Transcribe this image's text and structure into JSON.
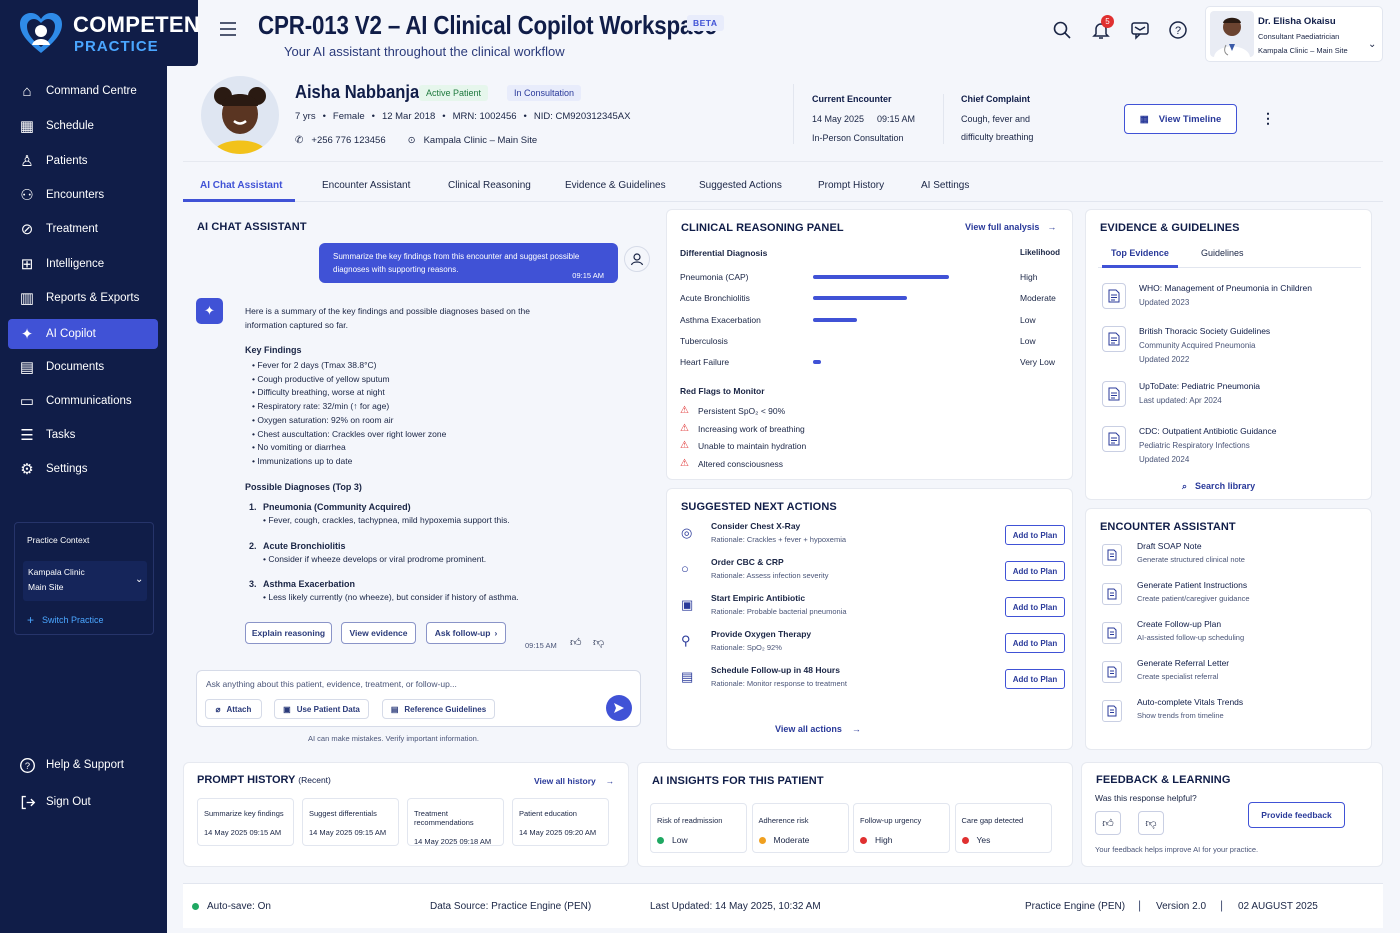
{
  "brand": {
    "line1": "COMPETEN",
    "line2": "PRACTICE"
  },
  "header": {
    "title": "CPR-013 V2 – AI Clinical Copilot Workspace",
    "beta": "BETA",
    "subtitle": "Your AI assistant throughout the clinical workflow",
    "notifications": "5",
    "user_name": "Dr. Elisha Okaisu",
    "user_role": "Consultant Paediatrician",
    "user_site": "Kampala Clinic – Main Site"
  },
  "nav": [
    "Command Centre",
    "Schedule",
    "Patients",
    "Encounters",
    "Treatment",
    "Intelligence",
    "Reports & Exports",
    "AI Copilot",
    "Documents",
    "Communications",
    "Tasks",
    "Settings"
  ],
  "nav_bottom": [
    "Help & Support",
    "Sign Out"
  ],
  "context": {
    "title": "Practice Context",
    "clinic": "Kampala Clinic",
    "site": "Main Site",
    "switch": "Switch Practice"
  },
  "patient": {
    "name": "Aisha Nabbanja",
    "status1": "Active Patient",
    "status2": "In Consultation",
    "age": "7 yrs",
    "sex": "Female",
    "dob": "12 Mar 2018",
    "mrn": "MRN: 1002456",
    "nid": "NID: CM920312345AX",
    "phone": "+256 776 123456",
    "clinic": "Kampala Clinic – Main Site",
    "enc_label": "Current Encounter",
    "enc_date": "14 May 2025",
    "enc_time": "09:15 AM",
    "enc_type": "In-Person Consultation",
    "cc_label": "Chief Complaint",
    "cc_line1": "Cough, fever and",
    "cc_line2": "difficulty breathing",
    "timeline": "View Timeline"
  },
  "tabs": [
    "AI Chat Assistant",
    "Encounter Assistant",
    "Clinical Reasoning",
    "Evidence & Guidelines",
    "Suggested Actions",
    "Prompt History",
    "AI Settings"
  ],
  "chat": {
    "title": "AI CHAT ASSISTANT",
    "user_msg_1": "Summarize the key findings from this encounter and suggest possible",
    "user_msg_2": "diagnoses with supporting reasons.",
    "user_time": "09:15 AM",
    "intro_1": "Here is a summary of the key findings and possible diagnoses based on the",
    "intro_2": "information captured so far.",
    "kf_title": "Key Findings",
    "findings": [
      "Fever for 2 days (Tmax 38.8°C)",
      "Cough productive of yellow sputum",
      "Difficulty breathing, worse at night",
      "Respiratory rate: 32/min (↑ for age)",
      "Oxygen saturation: 92% on room air",
      "Chest auscultation: Crackles over right lower zone",
      "No vomiting or diarrhea",
      "Immunizations up to date"
    ],
    "pd_title": "Possible Diagnoses (Top 3)",
    "dx": [
      {
        "num": "1.",
        "name": "Pneumonia (Community Acquired)",
        "note": "Fever, cough, crackles, tachypnea, mild hypoxemia support this."
      },
      {
        "num": "2.",
        "name": "Acute Bronchiolitis",
        "note": "Consider if wheeze develops or viral prodrome prominent."
      },
      {
        "num": "3.",
        "name": "Asthma Exacerbation",
        "note": "Less likely currently (no wheeze), but consider if history of asthma."
      }
    ],
    "btn_explain": "Explain reasoning",
    "btn_evidence": "View evidence",
    "btn_follow": "Ask follow-up",
    "ai_time": "09:15 AM",
    "input_placeholder": "Ask anything about this patient, evidence, treatment, or follow-up...",
    "attach": "Attach",
    "use_data": "Use Patient Data",
    "ref": "Reference Guidelines",
    "disclaimer": "AI can make mistakes. Verify important information."
  },
  "reasoning": {
    "title": "CLINICAL REASONING PANEL",
    "view_full": "View full analysis",
    "dd_label": "Differential Diagnosis",
    "lk_label": "Likelihood",
    "items": [
      {
        "name": "Pneumonia (CAP)",
        "level": "High",
        "value": 0.68
      },
      {
        "name": "Acute Bronchiolitis",
        "level": "Moderate",
        "value": 0.47
      },
      {
        "name": "Asthma Exacerbation",
        "level": "Low",
        "value": 0.22
      },
      {
        "name": "Tuberculosis",
        "level": "Low",
        "value": 0
      },
      {
        "name": "Heart Failure",
        "level": "Very Low",
        "value": 0.04
      }
    ],
    "rf_title": "Red Flags to Monitor",
    "flags": [
      "Persistent SpO₂ < 90%",
      "Increasing work of breathing",
      "Unable to maintain hydration",
      "Altered consciousness"
    ]
  },
  "actions": {
    "title": "SUGGESTED NEXT ACTIONS",
    "add": "Add to Plan",
    "view_all": "View all actions",
    "items": [
      {
        "name": "Consider Chest X-Ray",
        "rationale": "Rationale: Crackles + fever + hypoxemia"
      },
      {
        "name": "Order CBC & CRP",
        "rationale": "Rationale: Assess infection severity"
      },
      {
        "name": "Start Empiric Antibiotic",
        "rationale": "Rationale: Probable bacterial pneumonia"
      },
      {
        "name": "Provide Oxygen Therapy",
        "rationale": "Rationale: SpO₂ 92%"
      },
      {
        "name": "Schedule Follow-up in 48 Hours",
        "rationale": "Rationale: Monitor response to treatment"
      }
    ]
  },
  "evidence": {
    "title": "EVIDENCE & GUIDELINES",
    "tab1": "Top Evidence",
    "tab2": "Guidelines",
    "search": "Search library",
    "items": [
      {
        "l1": "WHO: Management of Pneumonia in Children",
        "l2": "Updated 2023",
        "l3": ""
      },
      {
        "l1": "British Thoracic Society Guidelines",
        "l2": "Community Acquired Pneumonia",
        "l3": "Updated 2022"
      },
      {
        "l1": "UpToDate: Pediatric Pneumonia",
        "l2": "Last updated: Apr 2024",
        "l3": ""
      },
      {
        "l1": "CDC: Outpatient Antibiotic Guidance",
        "l2": "Pediatric Respiratory Infections",
        "l3": "Updated 2024"
      }
    ]
  },
  "encounter": {
    "title": "ENCOUNTER ASSISTANT",
    "items": [
      {
        "name": "Draft SOAP Note",
        "desc": "Generate structured clinical note"
      },
      {
        "name": "Generate Patient Instructions",
        "desc": "Create patient/caregiver guidance"
      },
      {
        "name": "Create Follow-up Plan",
        "desc": "AI-assisted follow-up scheduling"
      },
      {
        "name": "Generate Referral Letter",
        "desc": "Create specialist referral"
      },
      {
        "name": "Auto-complete Vitals Trends",
        "desc": "Show trends from timeline"
      }
    ]
  },
  "history": {
    "title": "PROMPT HISTORY",
    "recent": "(Recent)",
    "view_all": "View all history",
    "items": [
      {
        "name": "Summarize key findings",
        "time": "14 May 2025 09:15 AM"
      },
      {
        "name": "Suggest differentials",
        "time": "14 May 2025 09:15 AM"
      },
      {
        "name": "Treatment recommendations",
        "time": "14 May 2025 09:18 AM"
      },
      {
        "name": "Patient education",
        "time": "14 May 2025 09:20 AM"
      }
    ]
  },
  "insights": {
    "title": "AI INSIGHTS FOR THIS PATIENT",
    "items": [
      {
        "label": "Risk of readmission",
        "value": "Low",
        "color": "#1fa862"
      },
      {
        "label": "Adherence risk",
        "value": "Moderate",
        "color": "#f0a020"
      },
      {
        "label": "Follow-up urgency",
        "value": "High",
        "color": "#e03030"
      },
      {
        "label": "Care gap detected",
        "value": "Yes",
        "color": "#e03030"
      }
    ]
  },
  "feedback": {
    "title": "FEEDBACK & LEARNING",
    "question": "Was this response helpful?",
    "provide": "Provide feedback",
    "note": "Your feedback helps improve AI for your practice."
  },
  "footer": {
    "autosave": "Auto-save: On",
    "source": "Data Source: Practice Engine (PEN)",
    "updated": "Last Updated: 14 May 2025, 10:32 AM",
    "engine": "Practice Engine (PEN)",
    "version": "Version 2.0",
    "date": "02 AUGUST 2025"
  },
  "colors": {
    "primary": "#4052d6",
    "navy": "#101d48",
    "low": "#1fa862",
    "moderate": "#f0a020",
    "high": "#e03030"
  }
}
